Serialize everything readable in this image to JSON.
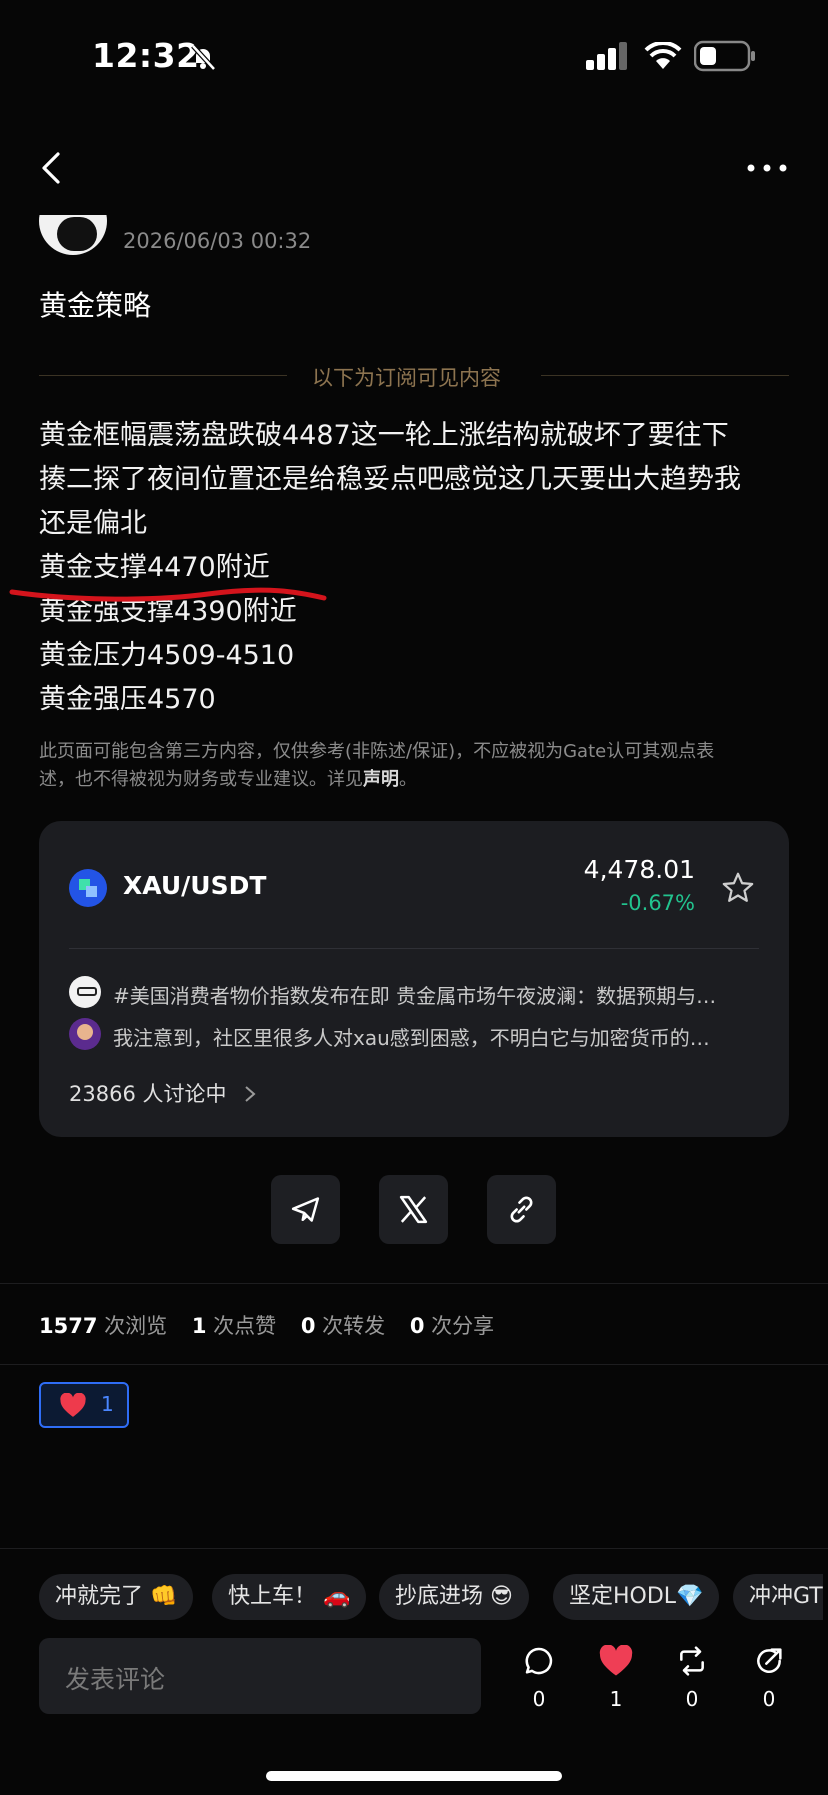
{
  "status_bar": {
    "time": "12:32"
  },
  "header": {
    "more_label": "···"
  },
  "post": {
    "timestamp": "2026/06/03 00:32",
    "title": "黄金策略",
    "subscription_divider": "以下为订阅可见内容",
    "body_lines": [
      "黄金框幅震荡盘跌破4487这一轮上涨结构就破坏了要往下",
      "揍二探了夜间位置还是给稳妥点吧感觉这几天要出大趋势我",
      "还是偏北",
      "黄金支撑4470附近",
      "黄金强支撑4390附近",
      "黄金压力4509-4510",
      "黄金强压4570"
    ],
    "disclaimer_line1": "此页面可能包含第三方内容，仅供参考(非陈述/保证)，不应被视为Gate认可其观点表",
    "disclaimer_line2": "述，也不得被视为财务或专业建议。详见",
    "disclaimer_link": "声明",
    "disclaimer_end": "。"
  },
  "market_card": {
    "pair": "XAU/USDT",
    "price": "4,478.01",
    "change": "-0.67%",
    "topics": [
      "#美国消费者物价指数发布在即 贵金属市场午夜波澜：数据预期与…",
      "我注意到，社区里很多人对xau感到困惑，不明白它与加密货币的…"
    ],
    "discussing": "23866 人讨论中",
    "colors": {
      "positive": "#22c38e",
      "background": "#1c1d21"
    }
  },
  "stats": {
    "views": "1577",
    "views_label": "次浏览",
    "likes": "1",
    "likes_label": "次点赞",
    "reposts": "0",
    "reposts_label": "次转发",
    "shares": "0",
    "shares_label": "次分享"
  },
  "reaction": {
    "emoji": "heart-icon",
    "count": "1"
  },
  "quick_replies": [
    "冲就完了 👊",
    "快上车！ 🚗",
    "抄底进场 😎",
    "坚定HODL💎",
    "冲冲GT"
  ],
  "comment_bar": {
    "placeholder": "发表评论",
    "comment_count": "0",
    "like_count": "1",
    "repost_count": "0",
    "share_count": "0"
  }
}
